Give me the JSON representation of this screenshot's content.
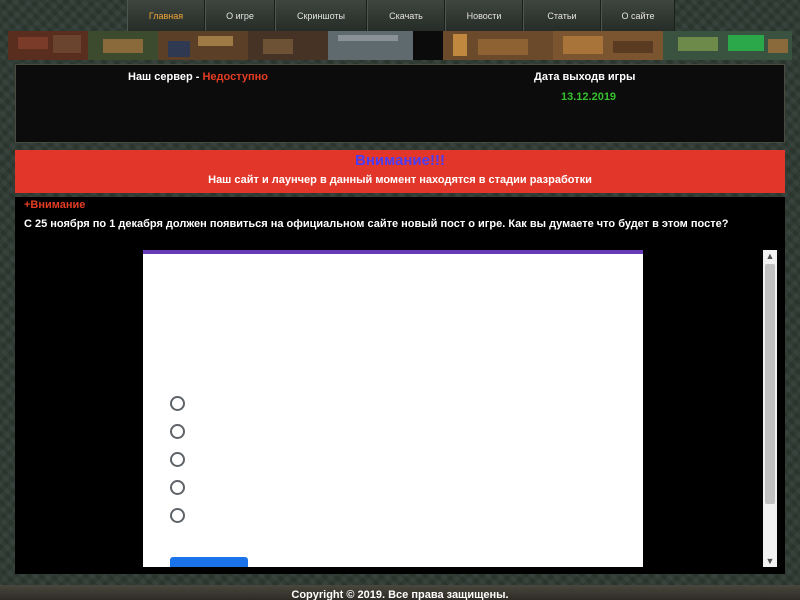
{
  "nav": {
    "items": [
      {
        "label": "Главная",
        "active": true
      },
      {
        "label": "О игре",
        "active": false
      },
      {
        "label": "Скриншоты",
        "active": false
      },
      {
        "label": "Скачать",
        "active": false
      },
      {
        "label": "Новости",
        "active": false
      },
      {
        "label": "Статьи",
        "active": false
      },
      {
        "label": "О сайте",
        "active": false
      }
    ]
  },
  "server": {
    "label": "Наш сервер - ",
    "status": "Недоступно",
    "status_color": "#e53c24"
  },
  "release": {
    "label": "Дата выходв игры",
    "date": "13.12.2019",
    "date_color": "#36c02e"
  },
  "warning": {
    "title": "Внимание!!!",
    "text": "Наш сайт и лаунчер в данный момент находятся в стадии разработки",
    "bg_color": "#e2362a"
  },
  "post": {
    "title": "+Внимание",
    "body": "С 25 ноября по 1 декабря должен появиться на официальном сайте новый пост о игре. Как вы думаете что будет в этом посте?"
  },
  "form": {
    "accent_color": "#673ab7",
    "option_count": 5,
    "submit_color": "#1a73e8"
  },
  "scrollbar": {
    "up_icon": "▲",
    "down_icon": "▼"
  },
  "footer": {
    "copyright": "Copyright © 2019. Все права защищены."
  }
}
